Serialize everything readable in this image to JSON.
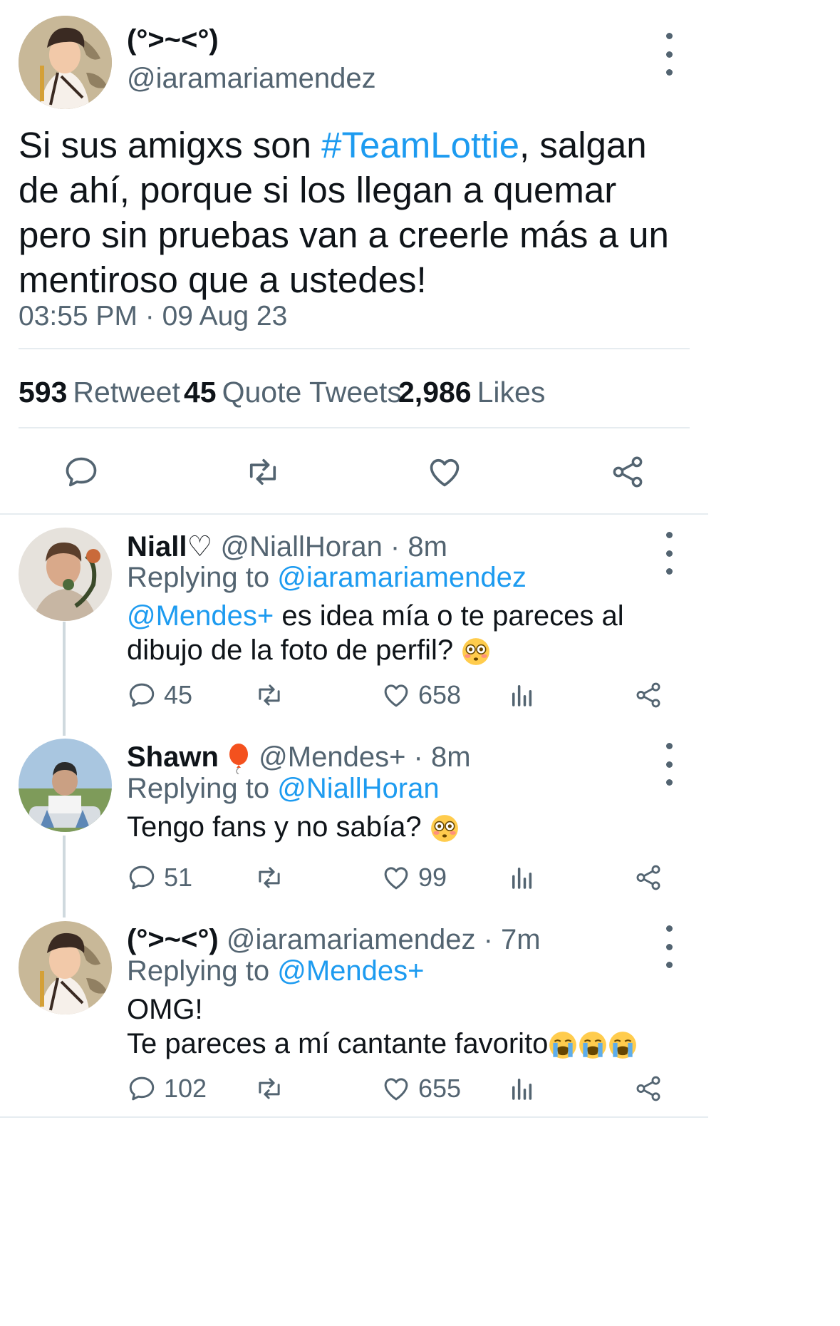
{
  "main_tweet": {
    "display_name": "(°>~<°)",
    "handle": "@iaramariamendez",
    "text_before": "Si sus amigxs son ",
    "hashtag": "#TeamLottie",
    "text_after": ", salgan de ahí, porque si los llegan a quemar pero sin pruebas van a creerle más a un mentiroso que a ustedes!",
    "timestamp": "03:55 PM · 09 Aug 23",
    "stats": {
      "retweets_count": "593",
      "retweets_label": "Retweet",
      "quotes_count": "45",
      "quotes_label": "Quote Tweets",
      "likes_count": "2,986",
      "likes_label": "Likes"
    },
    "actions": [
      "reply-icon",
      "retweet-icon",
      "like-icon",
      "share-icon"
    ]
  },
  "replies": [
    {
      "display_name": "Niall♡",
      "handle_time": "@NiallHoran · 8m",
      "replying_label": "Replying to ",
      "replying_to": "@iaramariamendez",
      "mention": "@Mendes+",
      "text": " es idea mía o te pareces al dibujo de la foto de perfil?",
      "emoji": "flushed-face",
      "reply_count": "45",
      "like_count": "658"
    },
    {
      "display_name": "Shawn",
      "badge_emoji": "balloon",
      "handle_time": "@Mendes+ · 8m",
      "replying_label": "Replying to ",
      "replying_to": "@NiallHoran",
      "text": "Tengo fans y no sabía?",
      "emoji": "flushed-face",
      "reply_count": "51",
      "like_count": "99"
    },
    {
      "display_name": "(°>~<°)",
      "handle_time": "@iaramariamendez · 7m",
      "replying_label": "Replying to ",
      "replying_to": "@Mendes+",
      "text_line1": "OMG!",
      "text_line2": "Te pareces a mí cantante favorito",
      "emoji": "loudly-crying-face x3",
      "reply_count": "102",
      "like_count": "655"
    }
  ],
  "colors": {
    "accent": "#1d9bf0",
    "text": "#0f1419",
    "muted": "#536471",
    "divider": "#e6ecf0"
  }
}
